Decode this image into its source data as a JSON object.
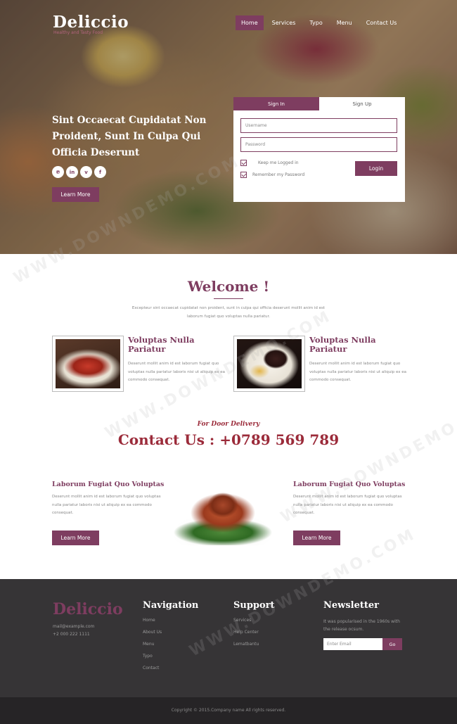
{
  "brand": {
    "name": "Deliccio",
    "tagline": "Healthy and Tasty Food"
  },
  "nav": {
    "items": [
      "Home",
      "Services",
      "Typo",
      "Menu",
      "Contact Us"
    ],
    "active": "Home"
  },
  "hero": {
    "title": "Sint Occaecat Cupidatat Non Proident, Sunt In Culpa Qui Officia Deserunt",
    "socials": [
      {
        "icon": "pinterest-icon",
        "glyph": "℗"
      },
      {
        "icon": "linkedin-icon",
        "glyph": "in"
      },
      {
        "icon": "vimeo-icon",
        "glyph": "v"
      },
      {
        "icon": "facebook-icon",
        "glyph": "f"
      }
    ],
    "learn_more": "Learn More"
  },
  "login": {
    "tabs": [
      "Sign In",
      "Sign Up"
    ],
    "username_placeholder": "Username",
    "password_placeholder": "Password",
    "keep_logged": "Keep me Logged in",
    "remember": "Remember my Password",
    "button": "Login"
  },
  "welcome": {
    "title": "Welcome !",
    "text": "Excepteur sint occaecat cupidatat non proident, sunt in culpa qui officia deserunt mollit anim id est laborum fugiat quo voluptas nulla pariatur."
  },
  "features": [
    {
      "title": "Voluptas Nulla Pariatur",
      "text": "Deserunt mollit anim id est laborum fugiat quo voluptas nulla pariatur laboris nisi ut aliquip ex ea commodo consequat."
    },
    {
      "title": "Voluptas Nulla Pariatur",
      "text": "Deserunt mollit anim id est laborum fugiat quo voluptas nulla pariatur laboris nisi ut aliquip ex ea commodo consequat."
    }
  ],
  "delivery": {
    "subtitle": "For Door Delivery",
    "contact": "Contact Us : +0789 569 789"
  },
  "columns": [
    {
      "title": "Laborum Fugiat Quo Voluptas",
      "text": "Deserunt mollit anim id est laborum fugiat quo voluptas nulla pariatur laboris nisi ut aliquip ex ea commodo consequat.",
      "button": "Learn More"
    },
    {
      "title": "Laborum Fugiat Quo Voluptas",
      "text": "Deserunt mollit anim id est laborum fugiat quo voluptas nulla pariatur laboris nisi ut aliquip ex ea commodo consequat.",
      "button": "Learn More"
    }
  ],
  "footer": {
    "logo": "Deliccio",
    "email": "mail@example.com",
    "phone": "+2 000 222 1111",
    "navigation": {
      "title": "Navigation",
      "items": [
        "Home",
        "About Us",
        "Menu",
        "Typo",
        "Contact"
      ]
    },
    "support": {
      "title": "Support",
      "items": [
        "Services",
        "Help Center",
        "Lematbantu"
      ]
    },
    "newsletter": {
      "title": "Newsletter",
      "text": "It was popularised in the 1960s with the release ocsum.",
      "placeholder": "Enter Email",
      "button": "Go"
    },
    "copyright": "Copyright © 2015.Company name All rights reserved."
  },
  "watermark": "WWW.DOWNDEMO.COM",
  "colors": {
    "accent": "#7e3d60",
    "contact": "#9b2b3a",
    "footer_bg": "#363436",
    "bottom_bg": "#262426"
  }
}
